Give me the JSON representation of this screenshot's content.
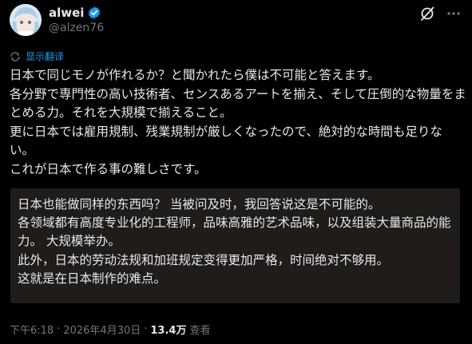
{
  "author": {
    "name": "alwei",
    "handle": "@alzen76"
  },
  "translate_link": "显示翻译",
  "post_text": "日本で同じモノが作れるか？と聞かれたら僕は不可能と答えます。\n各分野で専門性の高い技術者、センスあるアートを揃え、そして圧倒的な物量をまとめる力。それを大規模で揃えること。\n更に日本では雇用規制、残業規制が厳しくなったので、絶対的な時間も足りない。\nこれが日本で作る事の難しさです。",
  "translation_text": "日本也能做同样的东西吗？ 当被问及时，我回答说这是不可能的。\n各领域都有高度专业化的工程师，品味高雅的艺术品味，以及组装大量商品的能力。 大规模举办。\n此外，日本的劳动法规和加班规定变得更加严格，时间绝对不够用。\n这就是在日本制作的难点。",
  "meta": {
    "time": "下午6:18",
    "separator": "·",
    "date": "2026年4月30日",
    "views_count": "13.4万",
    "views_label": "查看"
  },
  "icons": {
    "verified": "verified-badge-icon",
    "grok": "grok-icon",
    "more": "more-options-icon",
    "translate": "translate-icon"
  },
  "colors": {
    "background": "#000000",
    "text": "#e7e9ea",
    "secondary_text": "#71767b",
    "accent": "#1d9bf0",
    "translation_box": "#1f1c1a"
  }
}
